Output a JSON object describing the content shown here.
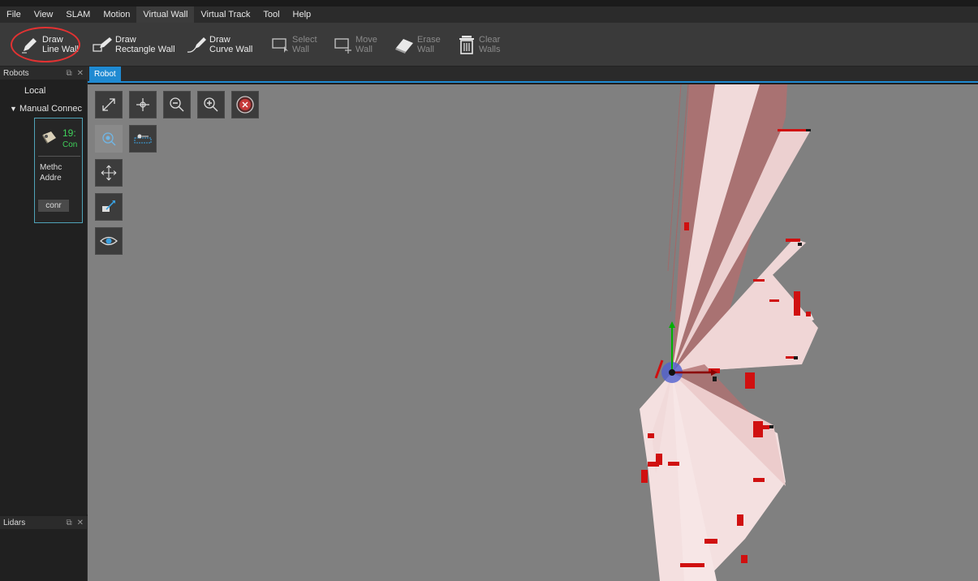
{
  "menubar": {
    "items": [
      {
        "label": "File"
      },
      {
        "label": "View"
      },
      {
        "label": "SLAM"
      },
      {
        "label": "Motion"
      },
      {
        "label": "Virtual Wall",
        "active": true
      },
      {
        "label": "Virtual Track"
      },
      {
        "label": "Tool"
      },
      {
        "label": "Help"
      }
    ]
  },
  "ribbon": {
    "draw_line_wall": {
      "line1": "Draw",
      "line2": "Line Wall",
      "icon": "pencil-icon"
    },
    "draw_rectangle_wall": {
      "line1": "Draw",
      "line2": "Rectangle Wall",
      "icon": "pencil-rectangle-icon"
    },
    "draw_curve_wall": {
      "line1": "Draw",
      "line2": "Curve Wall",
      "icon": "pencil-curve-icon"
    },
    "select_wall": {
      "line1": "Select",
      "line2": "Wall",
      "icon": "select-wall-icon",
      "enabled": false
    },
    "move_wall": {
      "line1": "Move",
      "line2": "Wall",
      "icon": "move-wall-icon",
      "enabled": false
    },
    "erase_wall": {
      "line1": "Erase",
      "line2": "Wall",
      "icon": "eraser-icon",
      "enabled": false
    },
    "clear_walls": {
      "line1": "Clear",
      "line2": "Walls",
      "icon": "trash-icon",
      "enabled": false
    }
  },
  "robots_panel": {
    "title": "Robots",
    "tree": {
      "local": "Local",
      "manual": "Manual Connec"
    },
    "card": {
      "ip": "19:",
      "status": "Con",
      "method": "Methc",
      "address": "Addre",
      "button": "conr"
    }
  },
  "lidars_panel": {
    "title": "Lidars"
  },
  "document": {
    "tab": "Robot"
  },
  "colors": {
    "accent": "#1f8ad2",
    "annotation": "#e23232",
    "connected": "#3fd15a",
    "map_bg": "#808080",
    "scan": "#f4dcdc",
    "obstacle": "#d01010"
  }
}
